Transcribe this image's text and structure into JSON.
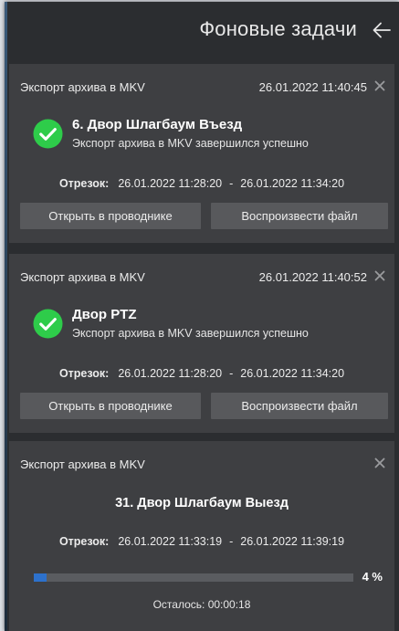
{
  "header": {
    "title": "Фоновые задачи"
  },
  "tasks": [
    {
      "title": "Экспорт архива в MKV",
      "time": "26.01.2022 11:40:45",
      "name": "6. Двор Шлагбаум Въезд",
      "status": "Экспорт архива в MKV завершился успешно",
      "segment_label": "Отрезок:",
      "segment_start": "26.01.2022 11:28:20",
      "segment_sep": "-",
      "segment_end": "26.01.2022 11:34:20",
      "open_label": "Открыть в проводнике",
      "play_label": "Воспроизвести файл"
    },
    {
      "title": "Экспорт архива в MKV",
      "time": "26.01.2022 11:40:52",
      "name": "Двор PTZ",
      "status": "Экспорт архива в MKV завершился успешно",
      "segment_label": "Отрезок:",
      "segment_start": "26.01.2022 11:28:20",
      "segment_sep": "-",
      "segment_end": "26.01.2022 11:34:20",
      "open_label": "Открыть в проводнике",
      "play_label": "Воспроизвести файл"
    },
    {
      "title": "Экспорт архива в MKV",
      "name": "31. Двор Шлагбаум Выезд",
      "segment_label": "Отрезок:",
      "segment_start": "26.01.2022 11:33:19",
      "segment_sep": "-",
      "segment_end": "26.01.2022 11:39:19",
      "progress_value": 0.04,
      "progress_text": "4 %",
      "remaining": "Осталось: 00:00:18"
    }
  ],
  "colors": {
    "panel_bg": "#2b2d30",
    "card_bg": "#3e3f42",
    "button_bg": "#58595c",
    "success_green": "#2ecc4a",
    "progress_blue": "#2d71cc"
  },
  "icons": [
    "back-arrow-icon",
    "close-icon",
    "check-circle-icon"
  ]
}
